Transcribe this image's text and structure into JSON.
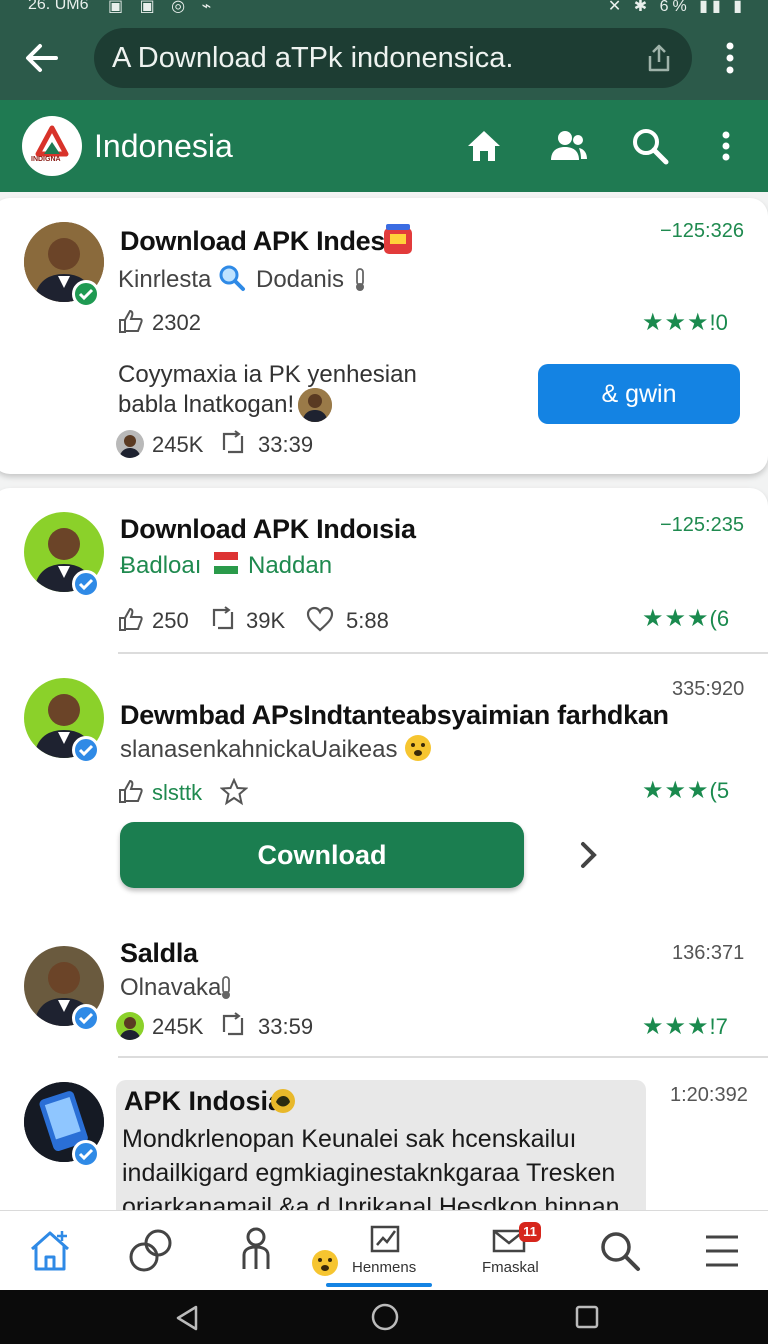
{
  "status_bar": {
    "time": "26. UM6",
    "battery": "6%"
  },
  "browser": {
    "url_text": "A Download aTPk indonensica.",
    "icons": [
      "back-arrow-icon",
      "share-icon",
      "kebab-icon"
    ]
  },
  "app_header": {
    "title": "Indonesia",
    "logo_text": "INDIGNA",
    "icons": [
      "home-icon",
      "users-icon",
      "search-icon",
      "kebab-icon"
    ]
  },
  "colors": {
    "header_green": "#1f7a52",
    "url_bar_dark": "#2c5a4a",
    "accent_blue": "#1483e3",
    "star_green": "#1a8a4e",
    "badge_red": "#d6261c"
  },
  "posts": [
    {
      "title": "Download APK Indesi",
      "subtitle_a": "Kinrlesta",
      "subtitle_b": "Dodanis",
      "timestamp": "−125:326",
      "likes": "2302",
      "rating": "!0",
      "description": "Coyymaxia ia PK yenhesian babla lnatkogan!",
      "button_label": "& gwin",
      "stat_a": "245K",
      "stat_b": "33:39"
    },
    {
      "title": "Download APK Indoısia",
      "subtitle_a": "Ƀadloaı",
      "subtitle_b": "Naddan",
      "timestamp": "−125:235",
      "likes": "250",
      "reposts": "39K",
      "hearts": "5:88",
      "rating": "(6"
    },
    {
      "title": "Dewmbad APsIndtanteabsyaimian farhdkan",
      "subtitle": "slanasenkahnickaUaikeas",
      "timestamp": "335:920",
      "likes": "slsttk",
      "rating": "(5",
      "button_label": "Cownload"
    },
    {
      "title": "Saldla",
      "subtitle": "Olnavaka",
      "timestamp": "136:371",
      "stat_a": "245K",
      "stat_b": "33:59",
      "rating": "!7"
    },
    {
      "title": "APK Indosia",
      "timestamp": "1:20:392",
      "message": "Mondkrlenopan Keunalei sak hcenskailuı indailkigard egmkiaginestaknkgaraa Tresken orjarkanamail &a d Inrikanal Hesdkon hinnan"
    }
  ],
  "bottom_nav": {
    "items": [
      {
        "icon": "home-icon"
      },
      {
        "icon": "circles-icon"
      },
      {
        "icon": "people-icon"
      },
      {
        "icon": "chart-icon",
        "label": "Henmens"
      },
      {
        "icon": "mail-icon",
        "label": "Fmaskal",
        "badge": "11"
      },
      {
        "icon": "search-icon"
      },
      {
        "icon": "menu-icon"
      }
    ]
  }
}
